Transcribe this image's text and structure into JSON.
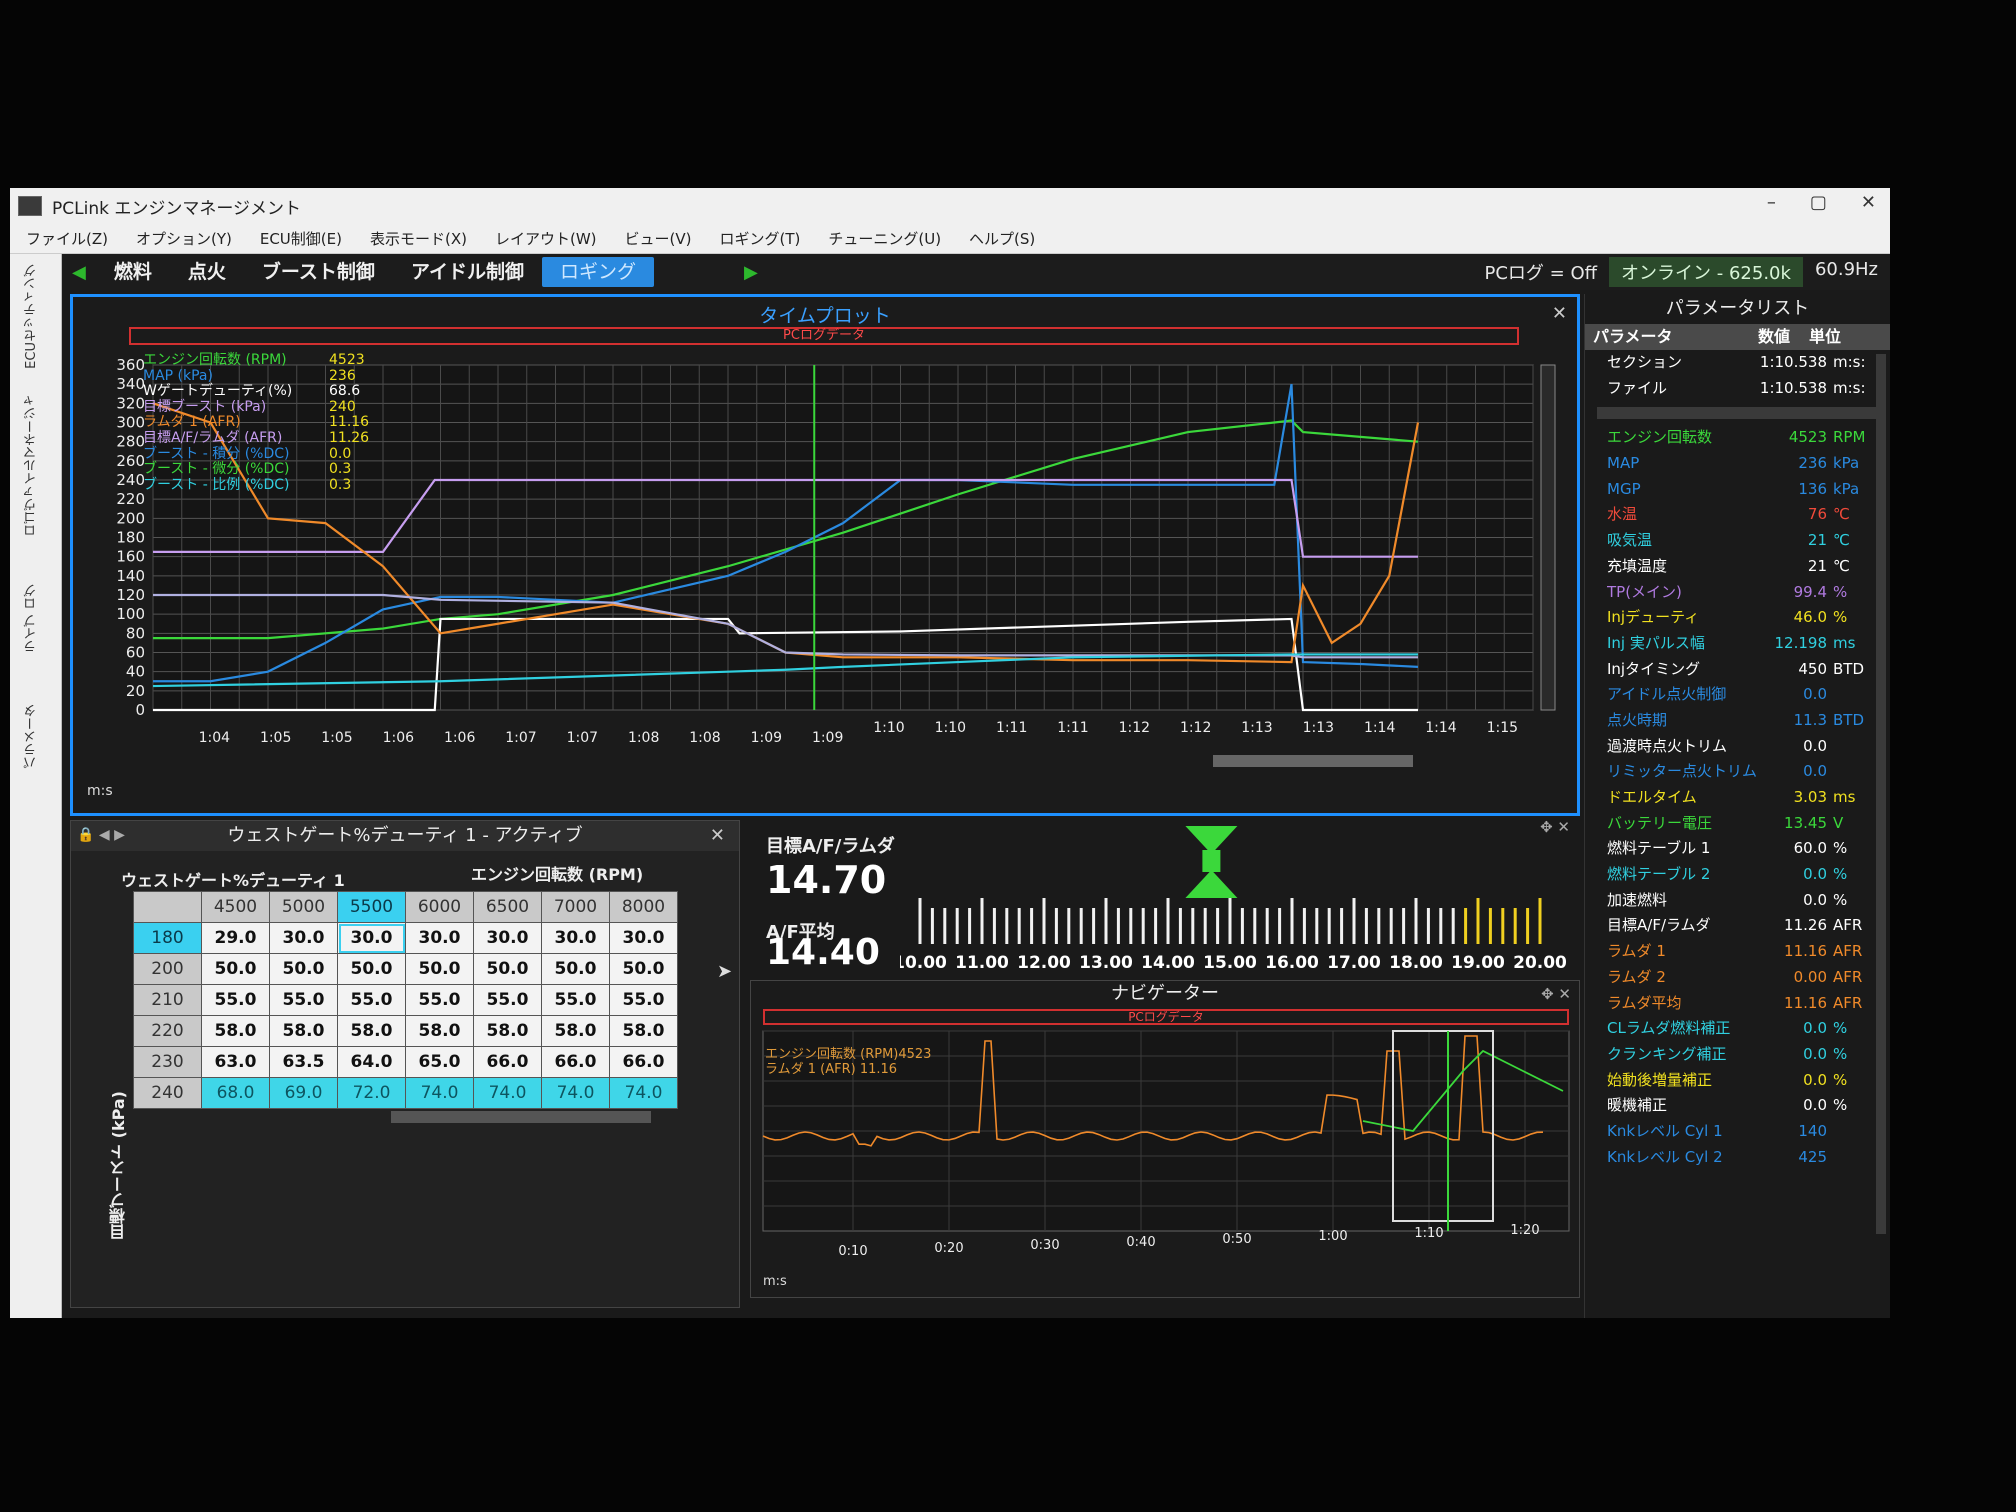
{
  "window": {
    "title": "PCLink エンジンマネージメント",
    "minimize": "–",
    "restore": "▢",
    "close": "✕"
  },
  "menu": [
    "ファイル(Z)",
    "オプション(Y)",
    "ECU制御(E)",
    "表示モード(X)",
    "レイアウト(W)",
    "ビュー(V)",
    "ロギング(T)",
    "チューニング(U)",
    "ヘルプ(S)"
  ],
  "left_strip": [
    "ECUセッティング",
    "ロゴヴァイルマネージャ",
    "ライブ ログ",
    "パラメータ"
  ],
  "tabs": [
    "燃料",
    "点火",
    "ブースト制御",
    "アイドル制御",
    "ロギング"
  ],
  "status": {
    "pclog": "PCログ = Off",
    "online": "オンライン - 625.0k",
    "rate": "60.9Hz"
  },
  "timeplot": {
    "title": "タイムプロット",
    "pclog_label": "PCログデータ",
    "ms_label": "m:s",
    "legend": [
      {
        "name": "エンジン回転数 (RPM)",
        "value": "4523",
        "color": "#3bd83b"
      },
      {
        "name": "MAP (kPa)",
        "value": "236",
        "color": "#2a8ae0"
      },
      {
        "name": "Wゲートデューティ(%)",
        "value": "68.6",
        "color": "#ffffff"
      },
      {
        "name": "目標ブースト (kPa)",
        "value": "240",
        "color": "#c79ef0"
      },
      {
        "name": "ラムダ 1 (AFR)",
        "value": "11.16",
        "color": "#f08a2a"
      },
      {
        "name": "目標A/F/ラムダ (AFR)",
        "value": "11.26",
        "color": "#c79ef0"
      },
      {
        "name": "ブースト - 積分 (%DC)",
        "value": "0.0",
        "color": "#2a8ae0"
      },
      {
        "name": "ブースト - 微分 (%DC)",
        "value": "0.3",
        "color": "#3bd83b"
      },
      {
        "name": "ブースト - 比例 (%DC)",
        "value": "0.3",
        "color": "#30d0e0"
      }
    ]
  },
  "chart_data": {
    "type": "line",
    "title": "タイムプロット",
    "xlabel": "m:s",
    "ylabel": "",
    "ylim": [
      0,
      360
    ],
    "y_ticks": [
      0,
      20,
      40,
      60,
      80,
      100,
      120,
      140,
      160,
      180,
      200,
      220,
      240,
      260,
      280,
      300,
      320,
      340,
      360
    ],
    "x_tick_labels": [
      "1:04",
      "1:05",
      "1:05",
      "1:06",
      "1:06",
      "1:07",
      "1:07",
      "1:08",
      "1:08",
      "1:09",
      "1:09",
      "1:10",
      "1:10",
      "1:11",
      "1:11",
      "1:12",
      "1:12",
      "1:13",
      "1:13",
      "1:14",
      "1:14",
      "1:15"
    ],
    "x_range": [
      0,
      24
    ],
    "grid": true,
    "series": [
      {
        "name": "エンジン回転数 (RPM)",
        "color": "#3bd83b",
        "x": [
          0,
          2,
          4,
          5,
          6,
          8,
          10,
          12,
          13,
          14,
          16,
          18,
          19.8,
          20,
          21,
          22
        ],
        "y": [
          75,
          75,
          85,
          95,
          100,
          120,
          150,
          185,
          205,
          225,
          262,
          290,
          302,
          290,
          285,
          280
        ]
      },
      {
        "name": "MAP (kPa)",
        "color": "#2a8ae0",
        "x": [
          0,
          1,
          2,
          3,
          4,
          5,
          6,
          8,
          10,
          11,
          12,
          13,
          14,
          16,
          18,
          19.5,
          19.8,
          20,
          21,
          22
        ],
        "y": [
          30,
          30,
          40,
          70,
          105,
          118,
          118,
          112,
          140,
          165,
          195,
          240,
          240,
          235,
          235,
          235,
          340,
          50,
          48,
          45
        ]
      },
      {
        "name": "Wゲートデューティ(%)",
        "color": "#ffffff",
        "x": [
          0,
          4.9,
          5,
          10,
          10.2,
          13,
          16,
          18,
          19.8,
          20,
          22
        ],
        "y": [
          0,
          0,
          95,
          95,
          80,
          82,
          88,
          92,
          95,
          0,
          0
        ]
      },
      {
        "name": "目標ブースト (kPa)",
        "color": "#c79ef0",
        "x": [
          0,
          4,
          4.9,
          5,
          19.8,
          20,
          22
        ],
        "y": [
          165,
          165,
          240,
          240,
          240,
          160,
          160
        ]
      },
      {
        "name": "ラムダ 1 (AFR)",
        "color": "#f08a2a",
        "x": [
          0,
          1,
          2,
          3,
          4,
          5,
          6,
          8,
          10,
          11,
          12,
          13,
          14,
          16,
          18,
          19.8,
          20,
          20.5,
          21,
          21.5,
          22
        ],
        "y": [
          320,
          300,
          200,
          195,
          150,
          80,
          90,
          110,
          90,
          60,
          55,
          55,
          55,
          52,
          52,
          50,
          130,
          70,
          90,
          140,
          300
        ]
      },
      {
        "name": "目標A/F/ラムダ (AFR)",
        "color": "#b0b0e0",
        "x": [
          0,
          4,
          5,
          8,
          10,
          11,
          12,
          14,
          16,
          18,
          19.8,
          20,
          22
        ],
        "y": [
          120,
          120,
          115,
          112,
          90,
          60,
          58,
          57,
          57,
          57,
          57,
          55,
          55
        ]
      },
      {
        "name": "ブースト - 比例 (%DC)",
        "color": "#30d0e0",
        "x": [
          0,
          5,
          10,
          11,
          12,
          14,
          16,
          19.8,
          20,
          22
        ],
        "y": [
          25,
          30,
          40,
          42,
          45,
          50,
          55,
          58,
          58,
          58
        ]
      }
    ]
  },
  "params": {
    "title": "パラメータリスト",
    "headers": [
      "パラメータ",
      "数値",
      "単位"
    ],
    "top_rows": [
      {
        "name": "セクション",
        "value": "1:10.538",
        "unit": "m:s:",
        "color": "#ffffff"
      },
      {
        "name": "ファイル",
        "value": "1:10.538",
        "unit": "m:s:",
        "color": "#ffffff"
      }
    ],
    "rows": [
      {
        "name": "エンジン回転数",
        "value": "4523",
        "unit": "RPM",
        "color": "#3bd83b"
      },
      {
        "name": "MAP",
        "value": "236",
        "unit": "kPa",
        "color": "#2a8ae0"
      },
      {
        "name": "MGP",
        "value": "136",
        "unit": "kPa",
        "color": "#2a8ae0"
      },
      {
        "name": "水温",
        "value": "76",
        "unit": "℃",
        "color": "#f04a3a"
      },
      {
        "name": "吸気温",
        "value": "21",
        "unit": "℃",
        "color": "#30d0e0"
      },
      {
        "name": "充填温度",
        "value": "21",
        "unit": "℃",
        "color": "#ffffff"
      },
      {
        "name": "TP(メイン)",
        "value": "99.4",
        "unit": "%",
        "color": "#b07ae0"
      },
      {
        "name": "Injデューティ",
        "value": "46.0",
        "unit": "%",
        "color": "#f0e020"
      },
      {
        "name": "Inj 実パルス幅",
        "value": "12.198",
        "unit": "ms",
        "color": "#30d0e0"
      },
      {
        "name": "Injタイミング",
        "value": "450",
        "unit": "BTD",
        "color": "#ffffff"
      },
      {
        "name": "アイドル点火制御",
        "value": "0.0",
        "unit": "",
        "color": "#2a8ae0"
      },
      {
        "name": "点火時期",
        "value": "11.3",
        "unit": "BTD",
        "color": "#2a8ae0"
      },
      {
        "name": "過渡時点火トリム",
        "value": "0.0",
        "unit": "",
        "color": "#ffffff"
      },
      {
        "name": "リミッター点火トリム",
        "value": "0.0",
        "unit": "",
        "color": "#2a8ae0"
      },
      {
        "name": "ドエルタイム",
        "value": "3.03",
        "unit": "ms",
        "color": "#f0e020"
      },
      {
        "name": "バッテリー電圧",
        "value": "13.45",
        "unit": "V",
        "color": "#3bd83b"
      },
      {
        "name": "燃料テーブル 1",
        "value": "60.0",
        "unit": "%",
        "color": "#ffffff"
      },
      {
        "name": "燃料テーブル 2",
        "value": "0.0",
        "unit": "%",
        "color": "#30d0e0"
      },
      {
        "name": "加速燃料",
        "value": "0.0",
        "unit": "%",
        "color": "#ffffff"
      },
      {
        "name": "目標A/F/ラムダ",
        "value": "11.26",
        "unit": "AFR",
        "color": "#ffffff"
      },
      {
        "name": "ラムダ 1",
        "value": "11.16",
        "unit": "AFR",
        "color": "#f08a2a"
      },
      {
        "name": "ラムダ 2",
        "value": "0.00",
        "unit": "AFR",
        "color": "#f08a2a"
      },
      {
        "name": "ラムダ平均",
        "value": "11.16",
        "unit": "AFR",
        "color": "#f08a2a"
      },
      {
        "name": "CLラムダ燃料補正",
        "value": "0.0",
        "unit": "%",
        "color": "#30d0e0"
      },
      {
        "name": "クランキング補正",
        "value": "0.0",
        "unit": "%",
        "color": "#30d0e0"
      },
      {
        "name": "始動後増量補正",
        "value": "0.0",
        "unit": "%",
        "color": "#f0e020"
      },
      {
        "name": "暖機補正",
        "value": "0.0",
        "unit": "%",
        "color": "#ffffff"
      },
      {
        "name": "Knkレベル Cyl 1",
        "value": "140",
        "unit": "",
        "color": "#2a8ae0"
      },
      {
        "name": "Knkレベル Cyl 2",
        "value": "425",
        "unit": "",
        "color": "#2a8ae0"
      }
    ]
  },
  "table": {
    "title": "ウェストゲート%デューティ 1 - アクティブ",
    "name": "ウェストゲート%デューティ 1",
    "x_axis": "エンジン回転数 (RPM)",
    "y_axis": "目標ブースト (kPa)",
    "cols": [
      "4500",
      "5000",
      "5500",
      "6000",
      "6500",
      "7000",
      "8000"
    ],
    "rows": [
      {
        "label": "180",
        "cells": [
          "29.0",
          "30.0",
          "30.0",
          "30.0",
          "30.0",
          "30.0",
          "30.0"
        ]
      },
      {
        "label": "200",
        "cells": [
          "50.0",
          "50.0",
          "50.0",
          "50.0",
          "50.0",
          "50.0",
          "50.0"
        ]
      },
      {
        "label": "210",
        "cells": [
          "55.0",
          "55.0",
          "55.0",
          "55.0",
          "55.0",
          "55.0",
          "55.0"
        ]
      },
      {
        "label": "220",
        "cells": [
          "58.0",
          "58.0",
          "58.0",
          "58.0",
          "58.0",
          "58.0",
          "58.0"
        ]
      },
      {
        "label": "230",
        "cells": [
          "63.0",
          "63.5",
          "64.0",
          "65.0",
          "66.0",
          "66.0",
          "66.0"
        ]
      },
      {
        "label": "240",
        "cells": [
          "68.0",
          "69.0",
          "72.0",
          "74.0",
          "74.0",
          "74.0",
          "74.0"
        ]
      }
    ]
  },
  "gauge": {
    "target_label": "目標A/F/ラムダ",
    "target_value": "14.70",
    "avg_label": "A/F平均",
    "avg_value": "14.40",
    "scale": [
      "10.00",
      "11.00",
      "12.00",
      "13.00",
      "14.00",
      "15.00",
      "16.00",
      "17.00",
      "18.00",
      "19.00",
      "20.00"
    ],
    "marker": 14.7
  },
  "navigator": {
    "title": "ナビゲーター",
    "pclog_label": "PCログデータ",
    "legend": [
      "エンジン回転数 (RPM)4523",
      "ラムダ 1 (AFR)  11.16"
    ],
    "ticks": [
      "0:10",
      "0:20",
      "0:30",
      "0:40",
      "0:50",
      "1:00",
      "1:10",
      "1:20"
    ],
    "ms_label": "m:s"
  }
}
